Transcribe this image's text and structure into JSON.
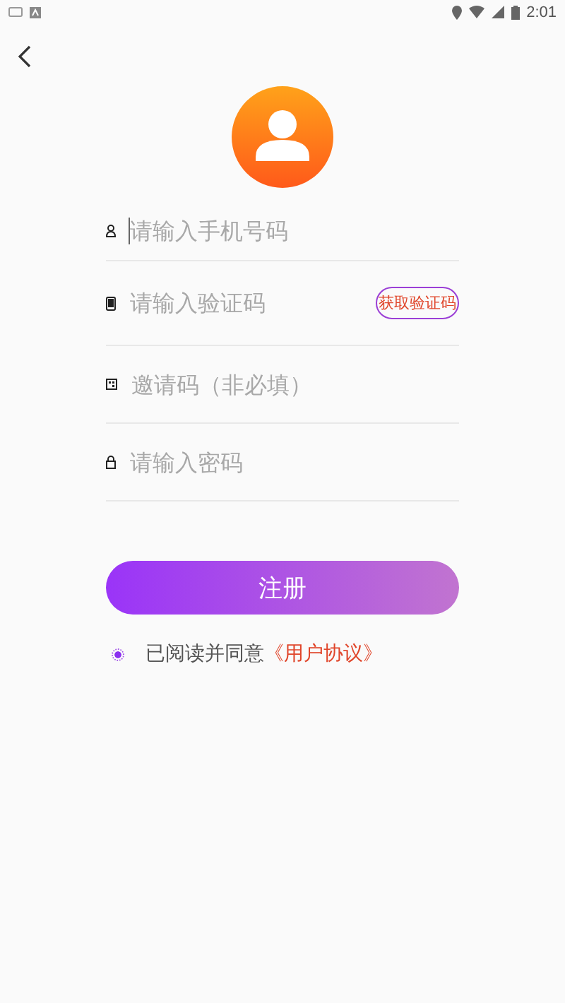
{
  "status_bar": {
    "time": "2:01"
  },
  "fields": [
    {
      "kind": "phone",
      "placeholder": "请输入手机号码",
      "focused": true
    },
    {
      "kind": "code",
      "placeholder": "请输入验证码",
      "button": "获取验证码"
    },
    {
      "kind": "invite",
      "placeholder": "邀请码（非必填）"
    },
    {
      "kind": "password",
      "placeholder": "请输入密码"
    }
  ],
  "submit": "注册",
  "agreement": {
    "checked": true,
    "text": "已阅读并同意",
    "link": "《用户协议》"
  }
}
